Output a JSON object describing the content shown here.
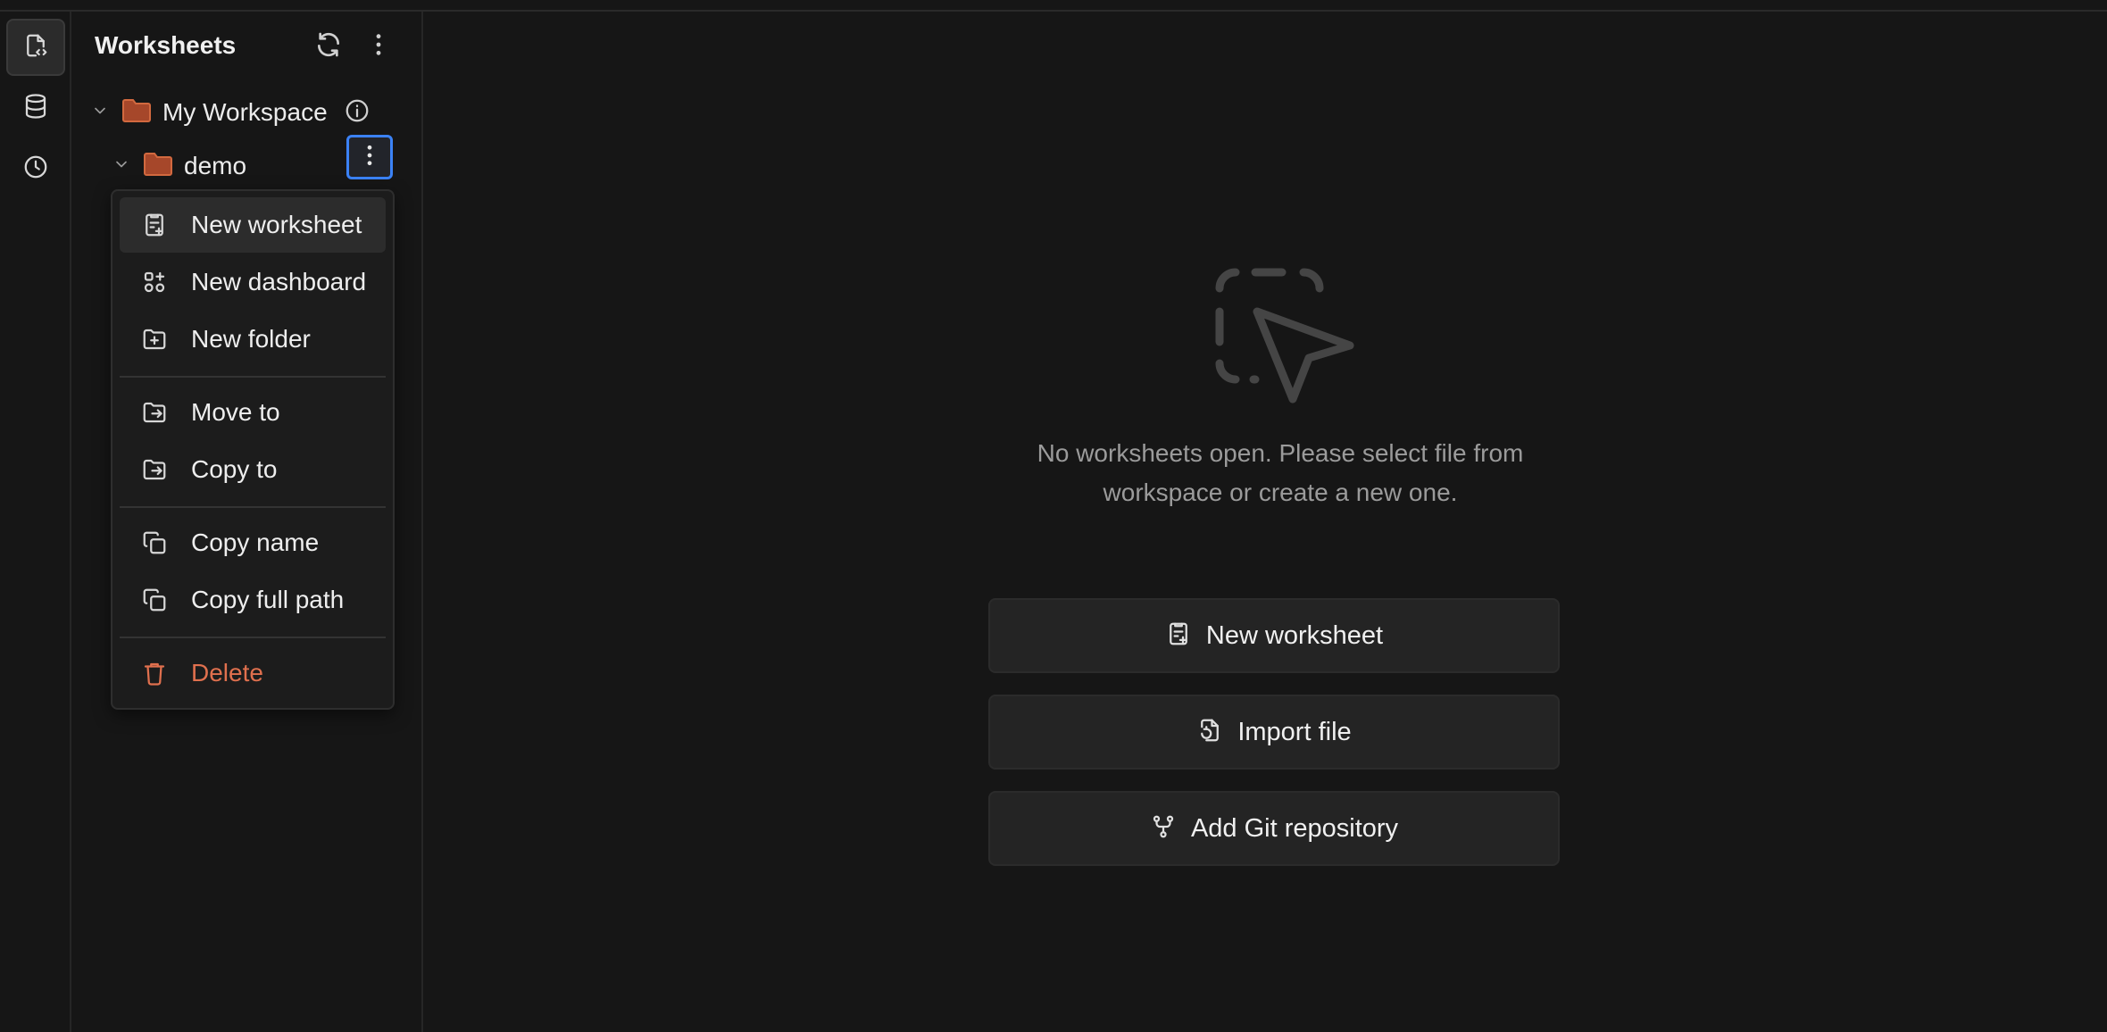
{
  "sidebar": {
    "title": "Worksheets",
    "refresh_icon": "refresh-icon",
    "more_icon": "more-vertical-icon",
    "tree": [
      {
        "label": "My Workspace",
        "icon": "folder-icon",
        "expanded": true
      },
      {
        "label": "demo",
        "icon": "folder-icon",
        "expanded": true
      }
    ]
  },
  "activity_bar": {
    "items": [
      {
        "icon": "worksheet-icon",
        "active": true
      },
      {
        "icon": "database-icon",
        "active": false
      },
      {
        "icon": "history-icon",
        "active": false
      }
    ]
  },
  "context_menu": {
    "items": [
      {
        "label": "New worksheet",
        "icon": "new-worksheet-icon"
      },
      {
        "label": "New dashboard",
        "icon": "new-dashboard-icon"
      },
      {
        "label": "New folder",
        "icon": "new-folder-icon"
      },
      {
        "label": "Move to",
        "icon": "move-to-icon"
      },
      {
        "label": "Copy to",
        "icon": "copy-to-icon"
      },
      {
        "label": "Copy name",
        "icon": "copy-icon"
      },
      {
        "label": "Copy full path",
        "icon": "copy-icon"
      },
      {
        "label": "Delete",
        "icon": "trash-icon"
      }
    ]
  },
  "main": {
    "empty_message_line1": "No worksheets open. Please select file from",
    "empty_message_line2": "workspace or create a new one.",
    "buttons": [
      {
        "label": "New worksheet",
        "icon": "new-worksheet-icon"
      },
      {
        "label": "Import file",
        "icon": "import-file-icon"
      },
      {
        "label": "Add Git repository",
        "icon": "git-branch-icon"
      }
    ]
  },
  "colors": {
    "background": "#161616",
    "folder": "#d2693f",
    "danger": "#e0704e",
    "focus_ring": "#3b82f6"
  }
}
